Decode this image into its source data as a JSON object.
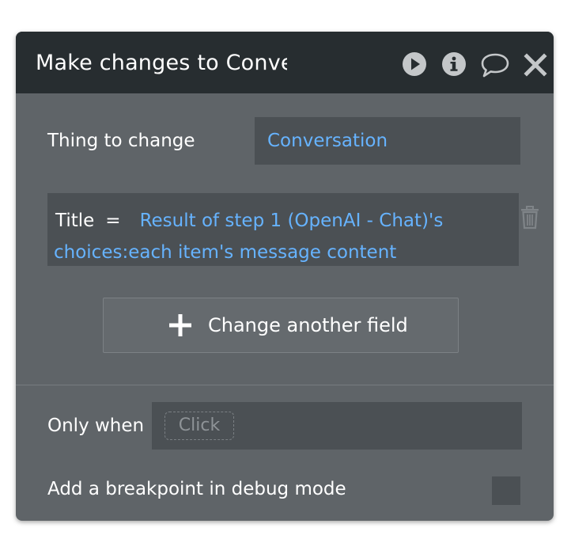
{
  "dialog": {
    "title": "Make changes to Conversation"
  },
  "header_icons": [
    "play-icon",
    "info-icon",
    "comment-icon",
    "close-icon"
  ],
  "thing_to_change": {
    "label": "Thing to change",
    "value": "Conversation"
  },
  "field": {
    "key": "Title",
    "operator": "=",
    "value": "Result of step 1 (OpenAI - Chat)'s choices:each item's message content"
  },
  "add_field_button": {
    "icon": "plus-icon",
    "label": "Change another field"
  },
  "only_when": {
    "label": "Only when",
    "placeholder": "Click"
  },
  "breakpoint": {
    "label": "Add a breakpoint in debug mode",
    "checked": false
  },
  "colors": {
    "header_bg": "#272d30",
    "panel_bg": "#5f6468",
    "input_bg": "#4b5054",
    "link": "#66b3ff",
    "icon": "#c4c7c9"
  }
}
